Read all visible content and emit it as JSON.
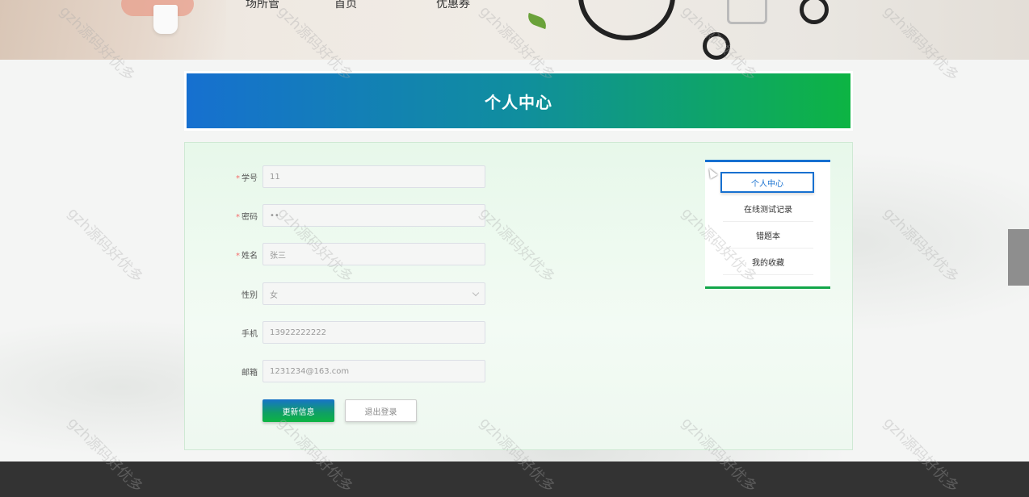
{
  "nav": {
    "items": [
      "场所管",
      "首页",
      "优惠券"
    ]
  },
  "title": "个人中心",
  "form": {
    "fields": [
      {
        "label": "学号",
        "required": true,
        "value": "11",
        "type": "text"
      },
      {
        "label": "密码",
        "required": true,
        "value": "••",
        "type": "password"
      },
      {
        "label": "姓名",
        "required": true,
        "value": "张三",
        "type": "text"
      },
      {
        "label": "性别",
        "required": false,
        "value": "女",
        "type": "select"
      },
      {
        "label": "手机",
        "required": false,
        "value": "13922222222",
        "type": "text"
      },
      {
        "label": "邮箱",
        "required": false,
        "value": "1231234@163.com",
        "type": "text"
      }
    ],
    "update_button": "更新信息",
    "logout_button": "退出登录"
  },
  "side_menu": {
    "items": [
      "个人中心",
      "在线测试记录",
      "错题本",
      "我的收藏"
    ],
    "active_index": 0
  },
  "watermark": "gzh源码好优多",
  "colors": {
    "primary_blue": "#1670d0",
    "primary_green": "#0db443",
    "required_star": "#f56c6c",
    "footer": "#333333"
  }
}
